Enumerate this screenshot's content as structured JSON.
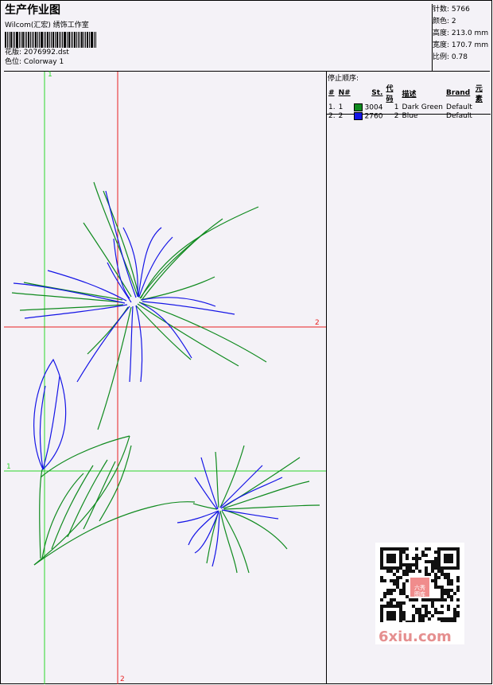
{
  "header": {
    "title": "生产作业图",
    "company": "Wilcom(汇宏) 绣饰工作室",
    "design_label": "花版:",
    "design_value": "2076992.dst",
    "colorway_label": "色位:",
    "colorway_value": "Colorway 1"
  },
  "stats": {
    "stitches_label": "针数:",
    "stitches_value": "5766",
    "colors_label": "颜色:",
    "colors_value": "2",
    "height_label": "高度:",
    "height_value": "213.0 mm",
    "width_label": "宽度:",
    "width_value": "170.7 mm",
    "scale_label": "比例:",
    "scale_value": "0.78"
  },
  "stop_sequence": {
    "caption": "停止顺序:",
    "headers": [
      "#",
      "N#",
      "St.",
      "代码",
      "描述",
      "Brand",
      "元素"
    ],
    "rows": [
      {
        "idx": "1.",
        "n": "1",
        "color": "#0f8a1e",
        "st": "3004",
        "code": "1",
        "desc": "Dark Green",
        "brand": "Default",
        "elem": ""
      },
      {
        "idx": "2.",
        "n": "2",
        "color": "#1414e6",
        "st": "2760",
        "code": "2",
        "desc": "Blue",
        "brand": "Default",
        "elem": ""
      }
    ]
  },
  "guides": {
    "green_marker": "1",
    "red_marker": "2"
  },
  "watermark": {
    "site": "6xiu.com",
    "seal": "六秀图库"
  }
}
